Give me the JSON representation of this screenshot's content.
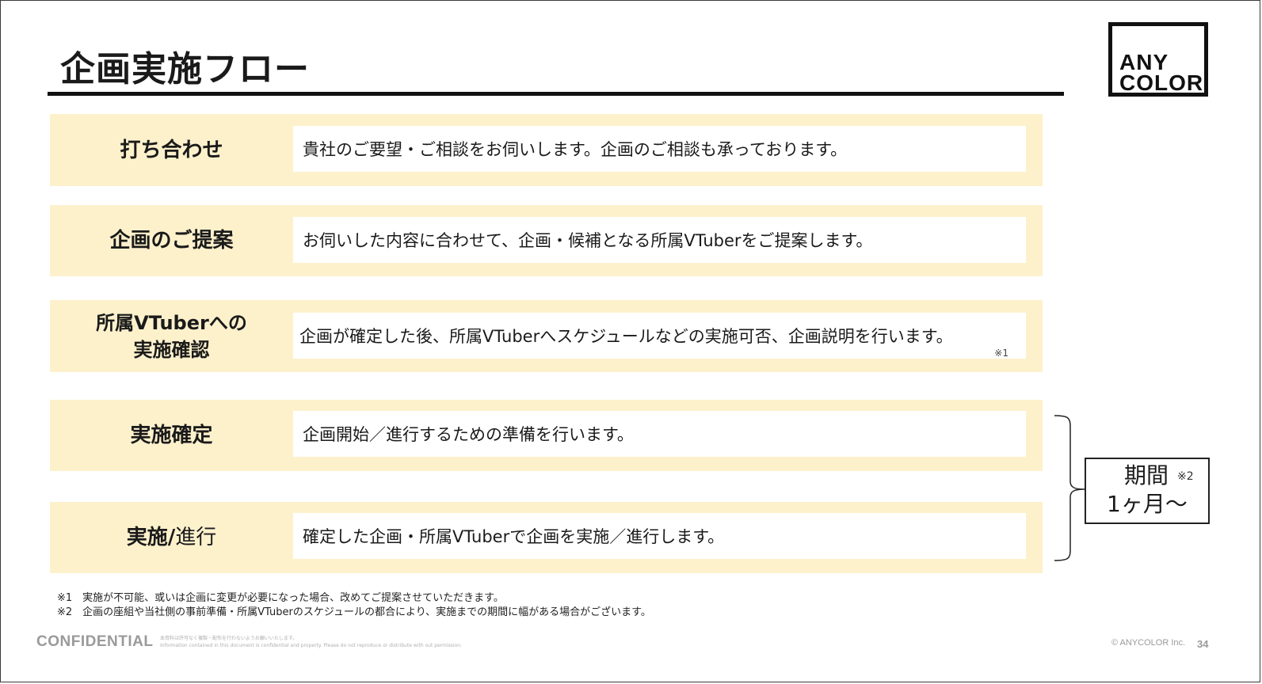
{
  "title": "企画実施フロー",
  "logo": {
    "line1": "ANY",
    "line2": "COLOR"
  },
  "steps": [
    {
      "label": "打ち合わせ",
      "text": "貴社のご要望・ご相談をお伺いします。企画のご相談も承っております。"
    },
    {
      "label": "企画のご提案",
      "text": "お伺いした内容に合わせて、企画・候補となる所属VTuberをご提案します。"
    },
    {
      "label_line1": "所属VTuberへの",
      "label_line2": "実施確認",
      "text": "企画が確定した後、所属VTuberへスケジュールなどの実施可否、企画説明を行います。",
      "note": "※1"
    },
    {
      "label": "実施確定",
      "text": "企画開始／進行するための準備を行います。"
    },
    {
      "label_a": "実施/",
      "label_b": "進行",
      "text": "確定した企画・所属VTuberで企画を実施／進行します。"
    }
  ],
  "period": {
    "label": "期間",
    "note": "※2",
    "value": "1ヶ月～"
  },
  "footnotes": [
    "※1　実施が不可能、或いは企画に変更が必要になった場合、改めてご提案させていただきます。",
    "※2　企画の座組や当社側の事前準備・所属VTuberのスケジュールの都合により、実施までの期間に幅がある場合がございます。"
  ],
  "footer": {
    "confidential": "CONFIDENTIAL",
    "disclaimer_ja": "本資料は許可なく複製・配布を行わないようお願いいたします。",
    "disclaimer_en": "Information contained in this document is confidential and property. Please do not reproduce or distribute with out permission.",
    "copyright": "© ANYCOLOR Inc.",
    "page": "34"
  },
  "colors": {
    "row_bg": "#fdf1cc",
    "text": "#1a1a1a",
    "footer_gray": "#9a9a9a"
  }
}
